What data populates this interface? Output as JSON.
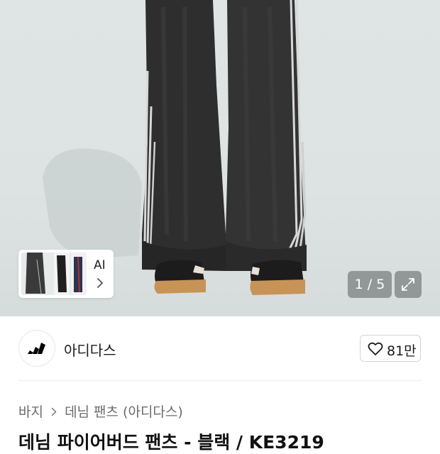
{
  "gallery": {
    "thumb_label": "AI",
    "page_indicator": "1 / 5"
  },
  "brand": {
    "name": "아디다스",
    "like_count": "81만"
  },
  "breadcrumb": {
    "items": [
      "바지",
      "데님 팬츠 (아디다스)"
    ]
  },
  "product": {
    "title": "데님 파이어버드 팬츠 - 블랙 / KE3219"
  },
  "icons": {
    "brand_logo": "adidas-logo",
    "like": "heart-icon",
    "expand": "expand-icon",
    "thumb_next": "chevron-right-icon",
    "crumb_separator": "chevron-right-icon"
  },
  "colors": {
    "overlay": "#5a5f5f",
    "text_primary": "#1a1a1a",
    "text_secondary": "#6b6b6b"
  }
}
